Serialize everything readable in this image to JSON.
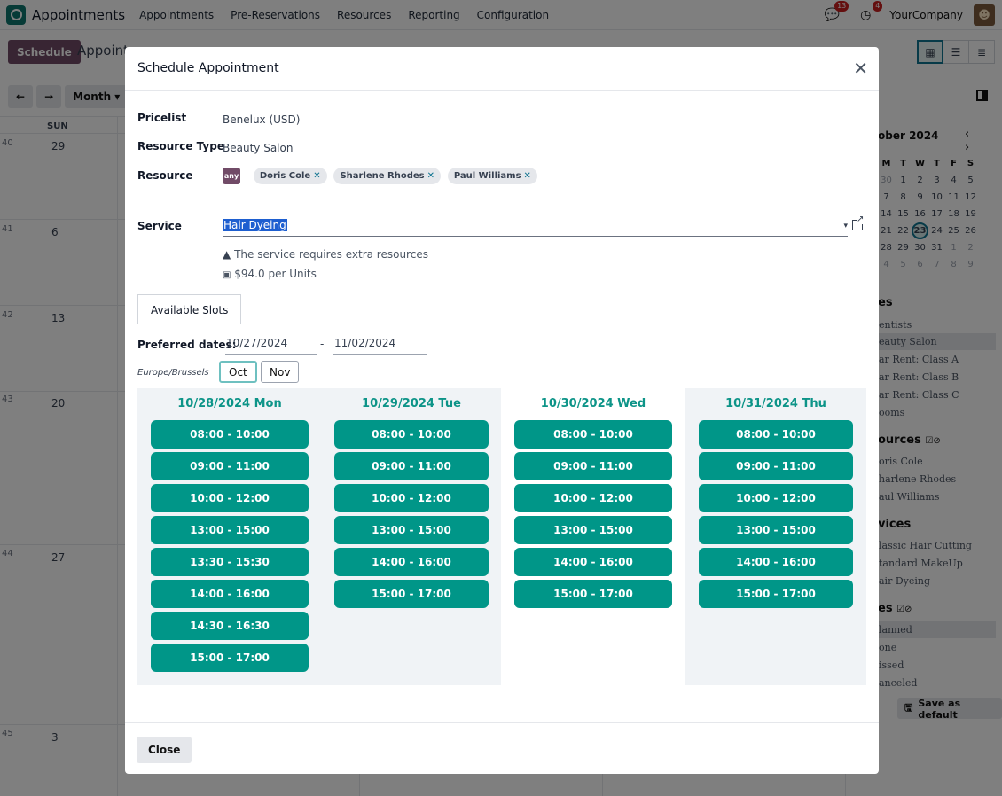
{
  "navbar": {
    "app_name": "Appointments",
    "menu": [
      "Appointments",
      "Pre-Reservations",
      "Resources",
      "Reporting",
      "Configuration"
    ],
    "messages_badge": "13",
    "activity_badge": "4",
    "company": "YourCompany"
  },
  "control": {
    "schedule_label": "Schedule",
    "breadcrumb": "Appoint",
    "month_label": "Month ▾"
  },
  "calendar_bg": {
    "sun_header": "SUN",
    "weeks": [
      {
        "week": "40",
        "day": "29"
      },
      {
        "week": "41",
        "day": "6"
      },
      {
        "week": "42",
        "day": "13"
      },
      {
        "week": "43",
        "day": "20"
      },
      {
        "week": "44",
        "day": "27"
      },
      {
        "week": "45",
        "day": "3"
      }
    ]
  },
  "sidebar": {
    "month_title": "ober 2024",
    "mini_header": [
      "M",
      "T",
      "W",
      "T",
      "F",
      "S"
    ],
    "mini_rows": [
      [
        "30",
        "1",
        "2",
        "3",
        "4",
        "5"
      ],
      [
        "7",
        "8",
        "9",
        "10",
        "11",
        "12"
      ],
      [
        "14",
        "15",
        "16",
        "17",
        "18",
        "19"
      ],
      [
        "21",
        "22",
        "23",
        "24",
        "25",
        "26"
      ],
      [
        "28",
        "29",
        "30",
        "31",
        "1",
        "2"
      ],
      [
        "4",
        "5",
        "6",
        "7",
        "8",
        "9"
      ]
    ],
    "types_heading": "es",
    "types": [
      "entists",
      "eauty Salon",
      "ar Rent: Class A",
      "ar Rent: Class B",
      "ar Rent: Class C",
      "ooms"
    ],
    "resources_heading": "ources",
    "resources": [
      "oris Cole",
      "harlene Rhodes",
      "aul Williams"
    ],
    "services_heading": "vices",
    "services": [
      "lassic Hair Cutting",
      "tandard MakeUp",
      "air Dyeing"
    ],
    "states_heading": "es",
    "states": [
      "lanned",
      "one",
      "issed",
      "anceled"
    ],
    "save_default": "Save as default"
  },
  "modal": {
    "title": "Schedule Appointment",
    "pricelist_label": "Pricelist",
    "pricelist_value": "Benelux (USD)",
    "resource_type_label": "Resource Type",
    "resource_type_value": "Beauty Salon",
    "resource_label": "Resource",
    "any_badge": "any",
    "resources": [
      "Doris Cole",
      "Sharlene Rhodes",
      "Paul Williams"
    ],
    "service_label": "Service",
    "service_value": "Hair Dyeing",
    "warning": "The service requires extra resources",
    "price": "$94.0 per Units",
    "tab_label": "Available Slots",
    "preferred_label": "Preferred dates:",
    "date_from": "10/27/2024",
    "date_to": "11/02/2024",
    "date_sep": "-",
    "timezone": "Europe/Brussels",
    "month_oct": "Oct",
    "month_nov": "Nov",
    "close_label": "Close"
  },
  "slots": [
    {
      "day": "10/28/2024 Mon",
      "times": [
        "08:00 - 10:00",
        "09:00 - 11:00",
        "10:00 - 12:00",
        "13:00 - 15:00",
        "13:30 - 15:30",
        "14:00 - 16:00",
        "14:30 - 16:30",
        "15:00 - 17:00"
      ]
    },
    {
      "day": "10/29/2024 Tue",
      "times": [
        "08:00 - 10:00",
        "09:00 - 11:00",
        "10:00 - 12:00",
        "13:00 - 15:00",
        "14:00 - 16:00",
        "15:00 - 17:00"
      ]
    },
    {
      "day": "10/30/2024 Wed",
      "times": [
        "08:00 - 10:00",
        "09:00 - 11:00",
        "10:00 - 12:00",
        "13:00 - 15:00",
        "14:00 - 16:00",
        "15:00 - 17:00"
      ]
    },
    {
      "day": "10/31/2024 Thu",
      "times": [
        "08:00 - 10:00",
        "09:00 - 11:00",
        "10:00 - 12:00",
        "13:00 - 15:00",
        "14:00 - 16:00",
        "15:00 - 17:00"
      ]
    }
  ],
  "colors": {
    "brand": "#714b67",
    "slot": "#009688",
    "slot_heading": "#0d9488",
    "selection": "#1e5fd0"
  }
}
